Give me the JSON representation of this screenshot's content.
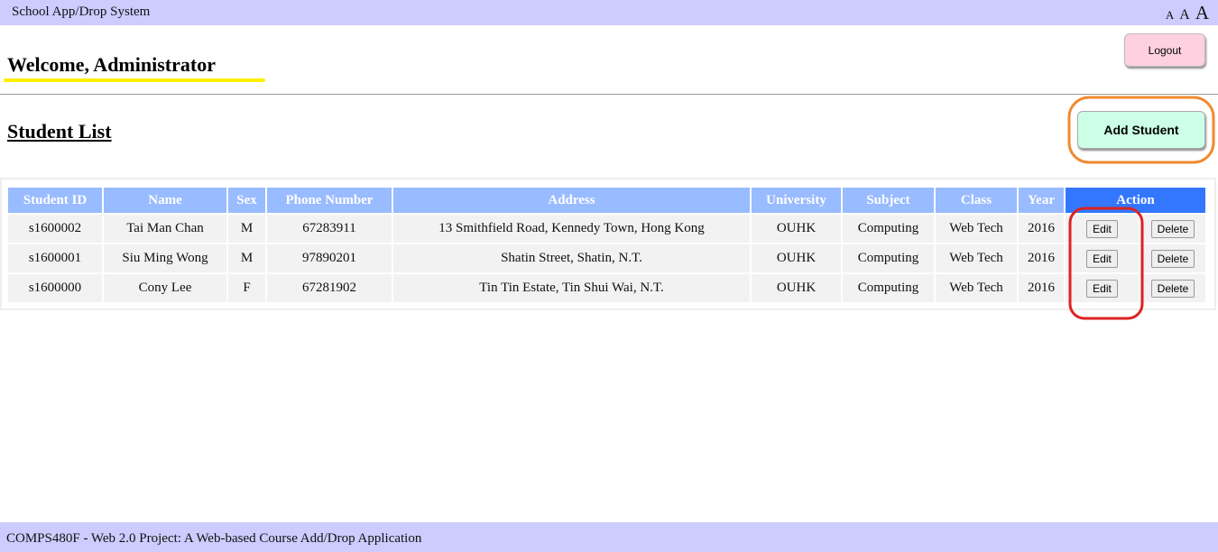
{
  "header": {
    "title": "School App/Drop System",
    "font_sizes": [
      "A",
      "A",
      "A"
    ]
  },
  "welcome": "Welcome, Administrator",
  "logout_label": "Logout",
  "list_title": "Student List",
  "add_label": "Add Student",
  "table": {
    "headers": [
      "Student ID",
      "Name",
      "Sex",
      "Phone Number",
      "Address",
      "University",
      "Subject",
      "Class",
      "Year",
      "Action"
    ],
    "edit_label": "Edit",
    "delete_label": "Delete",
    "rows": [
      [
        "s1600002",
        "Tai Man Chan",
        "M",
        "67283911",
        "13 Smithfield Road, Kennedy Town, Hong Kong",
        "OUHK",
        "Computing",
        "Web Tech",
        "2016"
      ],
      [
        "s1600001",
        "Siu Ming Wong",
        "M",
        "97890201",
        "Shatin Street, Shatin, N.T.",
        "OUHK",
        "Computing",
        "Web Tech",
        "2016"
      ],
      [
        "s1600000",
        "Cony Lee",
        "F",
        "67281902",
        "Tin Tin Estate, Tin Shui Wai, N.T.",
        "OUHK",
        "Computing",
        "Web Tech",
        "2016"
      ]
    ]
  },
  "footer": "COMPS480F - Web 2.0 Project: A Web-based Course Add/Drop Application",
  "colors": {
    "bar": "#ccccff",
    "header": "#99bbff",
    "action": "#3377ff",
    "highlight_yellow": "#ffee00",
    "highlight_orange": "#f08a30",
    "highlight_red": "#dd2222"
  }
}
